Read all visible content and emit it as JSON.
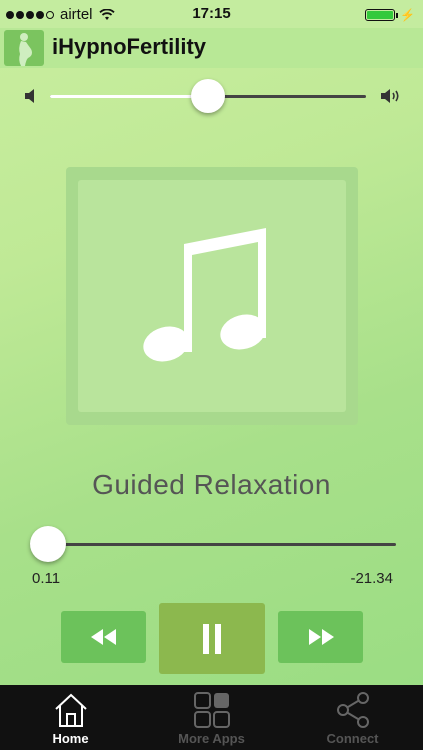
{
  "status_bar": {
    "carrier": "airtel",
    "time": "17:15",
    "signal_bars": 4,
    "battery_level": 1.0
  },
  "app": {
    "title": "iHypnoFertility",
    "logo_icon": "pregnant-silhouette-icon"
  },
  "volume": {
    "level": 0.5,
    "low_icon": "speaker-low-icon",
    "high_icon": "speaker-high-icon"
  },
  "now_playing": {
    "artwork_icon": "music-note-icon",
    "title": "Guided Relaxation",
    "progress": 0.005,
    "elapsed": "0.11",
    "remaining": "-21.34"
  },
  "controls": {
    "rewind_icon": "rewind-icon",
    "pause_icon": "pause-icon",
    "forward_icon": "fast-forward-icon"
  },
  "tabs": [
    {
      "label": "Home",
      "icon": "home-icon",
      "active": true
    },
    {
      "label": "More Apps",
      "icon": "grid-icon",
      "active": false
    },
    {
      "label": "Connect",
      "icon": "share-icon",
      "active": false
    }
  ],
  "colors": {
    "background": "#bfe996",
    "control_button": "#6cc25b",
    "play_button": "#8cb84e",
    "tabbar": "#111111"
  }
}
